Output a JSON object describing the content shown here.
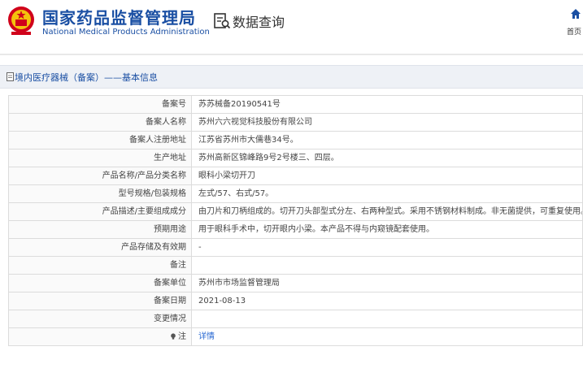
{
  "header": {
    "title_cn": "国家药品监督管理局",
    "title_en": "National Medical Products Administration",
    "query_title": "数据查询",
    "home_label": "首页"
  },
  "breadcrumb": "境内医疗器械（备案）——基本信息",
  "record": [
    {
      "label": "备案号",
      "value": "苏苏械备20190541号"
    },
    {
      "label": "备案人名称",
      "value": "苏州六六视觉科技股份有限公司"
    },
    {
      "label": "备案人注册地址",
      "value": "江苏省苏州市大儒巷34号。"
    },
    {
      "label": "生产地址",
      "value": "苏州高新区锦峰路9号2号楼三、四层。"
    },
    {
      "label": "产品名称/产品分类名称",
      "value": "眼科小梁切开刀"
    },
    {
      "label": "型号规格/包装规格",
      "value": "左式/57、右式/57。"
    },
    {
      "label": "产品描述/主要组成成分",
      "value": "由刀片和刀柄组成的。切开刀头部型式分左、右两种型式。采用不锈钢材料制成。非无菌提供，可重复使用。"
    },
    {
      "label": "预期用途",
      "value": "用于眼科手术中，切开眼内小梁。本产品不得与内窥镜配套使用。"
    },
    {
      "label": "产品存储及有效期",
      "value": "-"
    },
    {
      "label": "备注",
      "value": ""
    },
    {
      "label": "备案单位",
      "value": "苏州市市场监督管理局"
    },
    {
      "label": "备案日期",
      "value": "2021-08-13"
    },
    {
      "label": "变更情况",
      "value": ""
    }
  ],
  "note": {
    "label": "注",
    "link": "详情"
  },
  "colors": {
    "brand_blue": "#1a4fa3",
    "emblem_red": "#d0021b",
    "link_blue": "#2a6ad3"
  }
}
